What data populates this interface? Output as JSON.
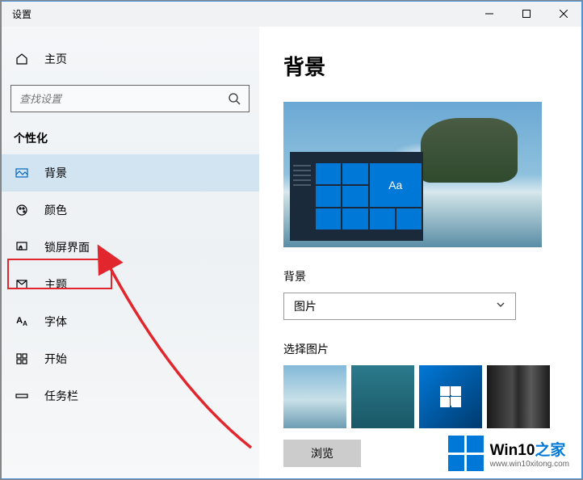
{
  "window": {
    "title": "设置"
  },
  "sidebar": {
    "home": "主页",
    "searchPlaceholder": "查找设置",
    "section": "个性化",
    "items": [
      {
        "label": "背景"
      },
      {
        "label": "颜色"
      },
      {
        "label": "锁屏界面"
      },
      {
        "label": "主题"
      },
      {
        "label": "字体"
      },
      {
        "label": "开始"
      },
      {
        "label": "任务栏"
      }
    ]
  },
  "content": {
    "title": "背景",
    "previewTile": "Aa",
    "bgLabel": "背景",
    "bgDropdown": "图片",
    "selectPic": "选择图片",
    "browse": "浏览"
  },
  "watermark": {
    "brand1": "Win10",
    "brand2": "之家",
    "url": "www.win10xitong.com"
  }
}
